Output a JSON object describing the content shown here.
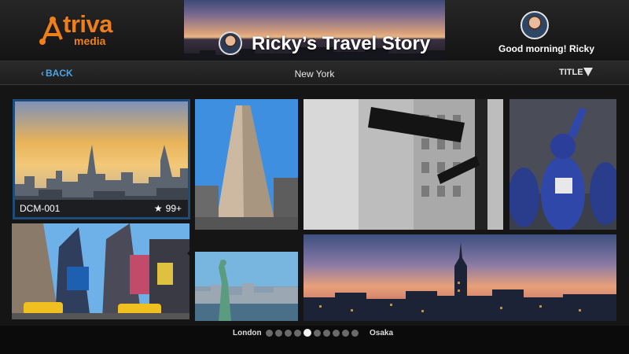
{
  "app": {
    "logo_text": "triva",
    "logo_subtext": "media",
    "brand_color": "#f07f1a"
  },
  "header": {
    "banner_title": "Ricky’s  Travel Story",
    "greeting": "Good morning!  Ricky"
  },
  "subnav": {
    "back_label": "BACK",
    "back_chevron": "‹",
    "city": "New York",
    "sort_label": "TITLE",
    "accent_color": "#4aa3e8"
  },
  "gallery": {
    "featured": {
      "id": "DCM-001",
      "star_glyph": "★",
      "rating": "99+"
    }
  },
  "pager": {
    "prev_label": "London",
    "next_label": "Osaka",
    "total_pages": 10,
    "current_page": 5
  }
}
